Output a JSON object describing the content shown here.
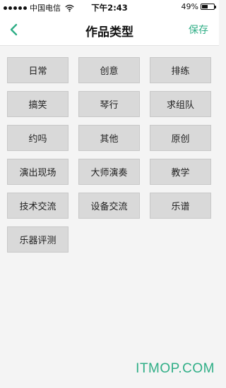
{
  "status_bar": {
    "carrier": "中国电信",
    "time": "下午2:43",
    "battery": "49%",
    "battery_level": 0.49
  },
  "nav": {
    "title": "作品类型",
    "save_label": "保存",
    "back_icon": "chevron-left-icon",
    "accent_color": "#2fae86"
  },
  "categories": [
    "日常",
    "创意",
    "排练",
    "搞笑",
    "琴行",
    "求组队",
    "约吗",
    "其他",
    "原创",
    "演出现场",
    "大师演奏",
    "教学",
    "技术交流",
    "设备交流",
    "乐谱",
    "乐器评测"
  ],
  "watermark": "ITMOP.COM"
}
